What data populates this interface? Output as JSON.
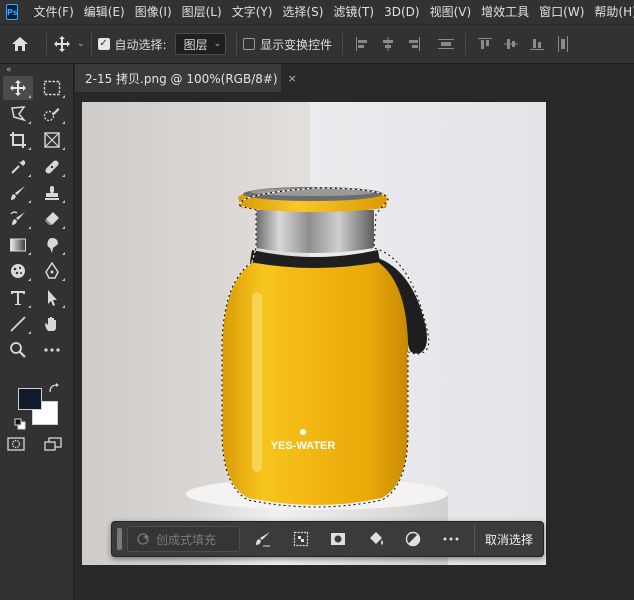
{
  "app": {
    "logo_text": "Ps"
  },
  "menu": [
    "文件(F)",
    "编辑(E)",
    "图像(I)",
    "图层(L)",
    "文字(Y)",
    "选择(S)",
    "滤镜(T)",
    "3D(D)",
    "视图(V)",
    "增效工具",
    "窗口(W)",
    "帮助(H)"
  ],
  "options_bar": {
    "auto_select_label": "自动选择:",
    "auto_select_checked": true,
    "auto_select_target": "图层",
    "show_transform_label": "显示变换控件",
    "show_transform_checked": false
  },
  "document": {
    "tab_title": "2-15 拷贝.png @ 100%(RGB/8#)",
    "close_glyph": "×"
  },
  "canvas_image": {
    "bottle_brand": "YES-WATER"
  },
  "colors": {
    "foreground": "#0f1b2d",
    "background": "#ffffff",
    "bottle_yellow": "#f2b81a",
    "ui_panel": "#323232",
    "workspace": "#282828"
  },
  "contextual_taskbar": {
    "generative_fill_label": "创成式填充",
    "deselect_label": "取消选择"
  },
  "tools": [
    "move-tool",
    "marquee-tool",
    "lasso-tool",
    "quick-selection-tool",
    "crop-tool",
    "frame-tool",
    "eyedropper-tool",
    "spot-healing-tool",
    "brush-tool",
    "clone-stamp-tool",
    "history-brush-tool",
    "eraser-tool",
    "gradient-tool",
    "smudge-tool",
    "dodge-tool",
    "pen-tool",
    "type-tool",
    "path-selection-tool",
    "line-tool",
    "hand-tool",
    "zoom-tool",
    "more-tools"
  ]
}
